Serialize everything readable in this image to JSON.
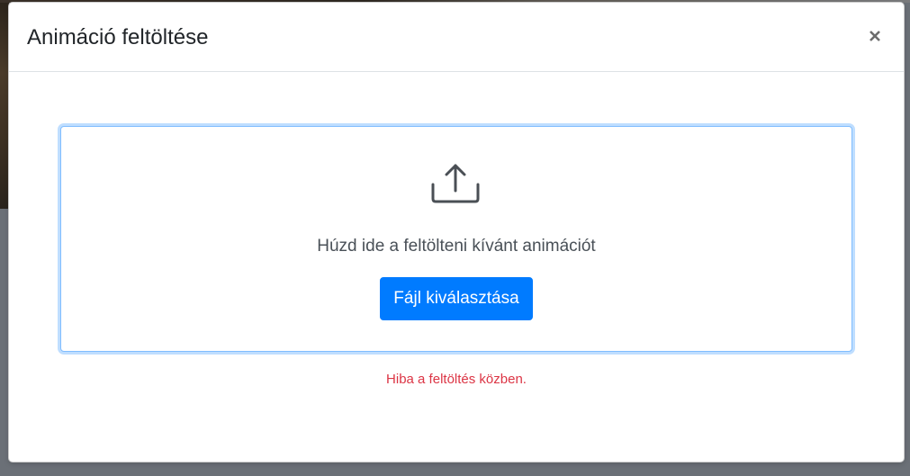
{
  "modal": {
    "title": "Animáció feltöltése",
    "close_label": "×"
  },
  "dropzone": {
    "icon": "upload-icon",
    "text": "Húzd ide a feltölteni kívánt animációt",
    "button_label": "Fájl kiválasztása"
  },
  "status": {
    "error_text": "Hiba a feltöltés közben."
  },
  "colors": {
    "primary": "#007bff",
    "error": "#dc3545",
    "focus_border": "#80bdff"
  }
}
